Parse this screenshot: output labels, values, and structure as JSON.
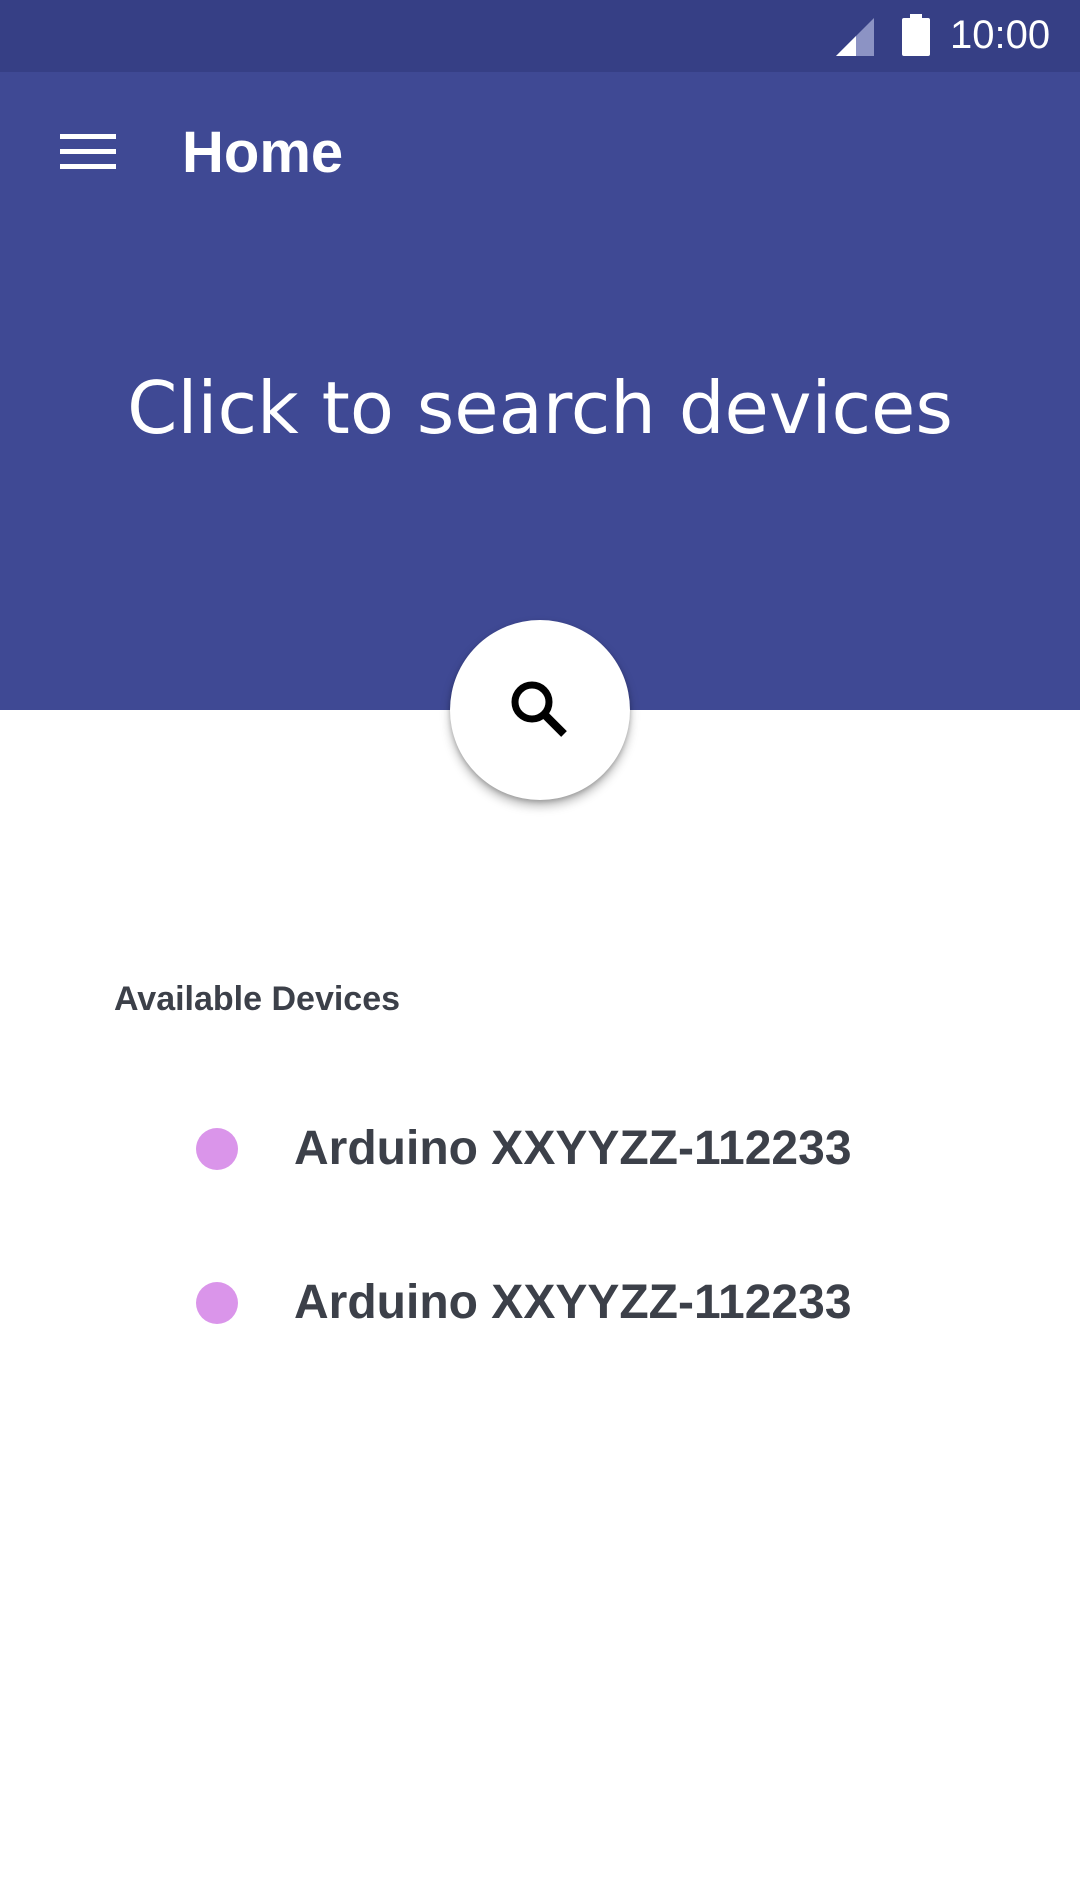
{
  "status_bar": {
    "time": "10:00",
    "icons": [
      "signal-icon",
      "battery-icon"
    ]
  },
  "header": {
    "title": "Home",
    "menu_icon": "menu-icon",
    "prompt": "Click to search devices",
    "background_color": "#3f4994",
    "status_bar_color": "#363f85"
  },
  "search_button": {
    "icon": "search-icon"
  },
  "devices_section": {
    "label": "Available Devices",
    "items": [
      {
        "name": "Arduino XXYYZZ-112233",
        "status_color": "#da95ea"
      },
      {
        "name": "Arduino XXYYZZ-112233",
        "status_color": "#da95ea"
      }
    ]
  }
}
